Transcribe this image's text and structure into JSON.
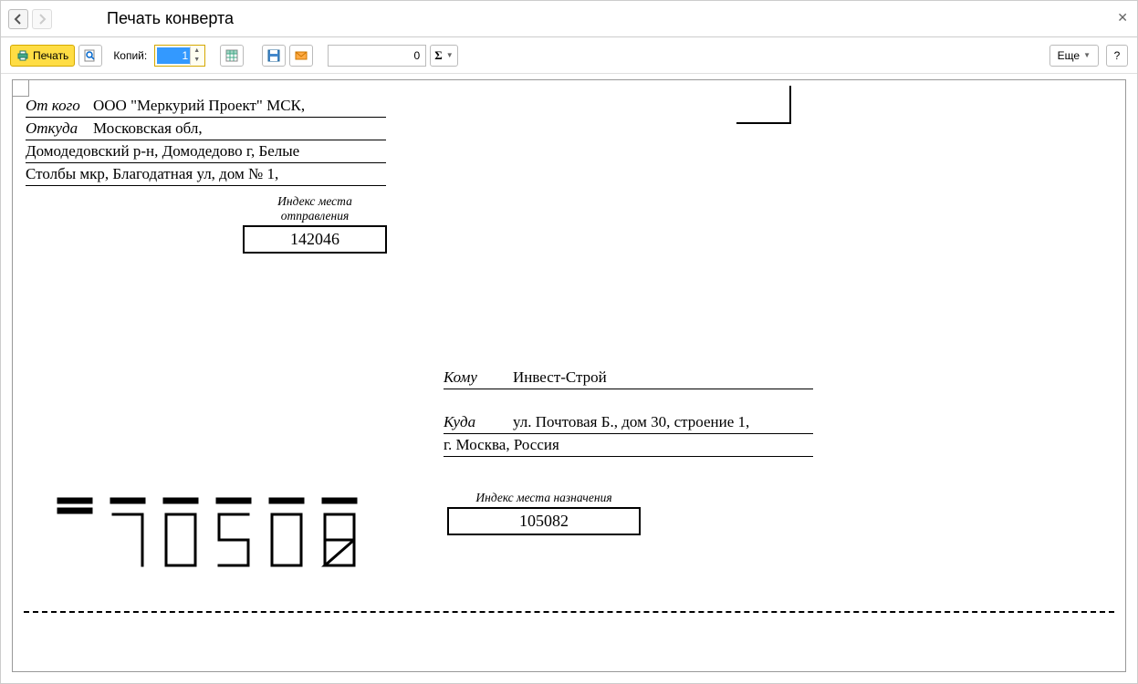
{
  "window": {
    "title": "Печать конверта"
  },
  "toolbar": {
    "print_label": "Печать",
    "copies_label": "Копий:",
    "copies_value": "1",
    "num_value": "0",
    "more_label": "Еще",
    "help_label": "?"
  },
  "envelope": {
    "sender": {
      "from_label": "От кого",
      "from_value": "ООО \"Меркурий Проект\" МСК,",
      "where_label": "Откуда",
      "where_value": "Московская обл,",
      "addr_line2": "Домодедовский р-н, Домодедово г, Белые",
      "addr_line3": "Столбы мкр, Благодатная ул, дом № 1,",
      "index_label": "Индекс места отправления",
      "index_value": "142046"
    },
    "recipient": {
      "to_label": "Кому",
      "to_value": "Инвест-Строй",
      "where_label": "Куда",
      "where_value": "ул. Почтовая Б., дом 30, строение 1,",
      "addr_line2": "г. Москва, Россия",
      "index_label": "Индекс места назначения",
      "index_value": "105082"
    },
    "big_index": "105082"
  }
}
